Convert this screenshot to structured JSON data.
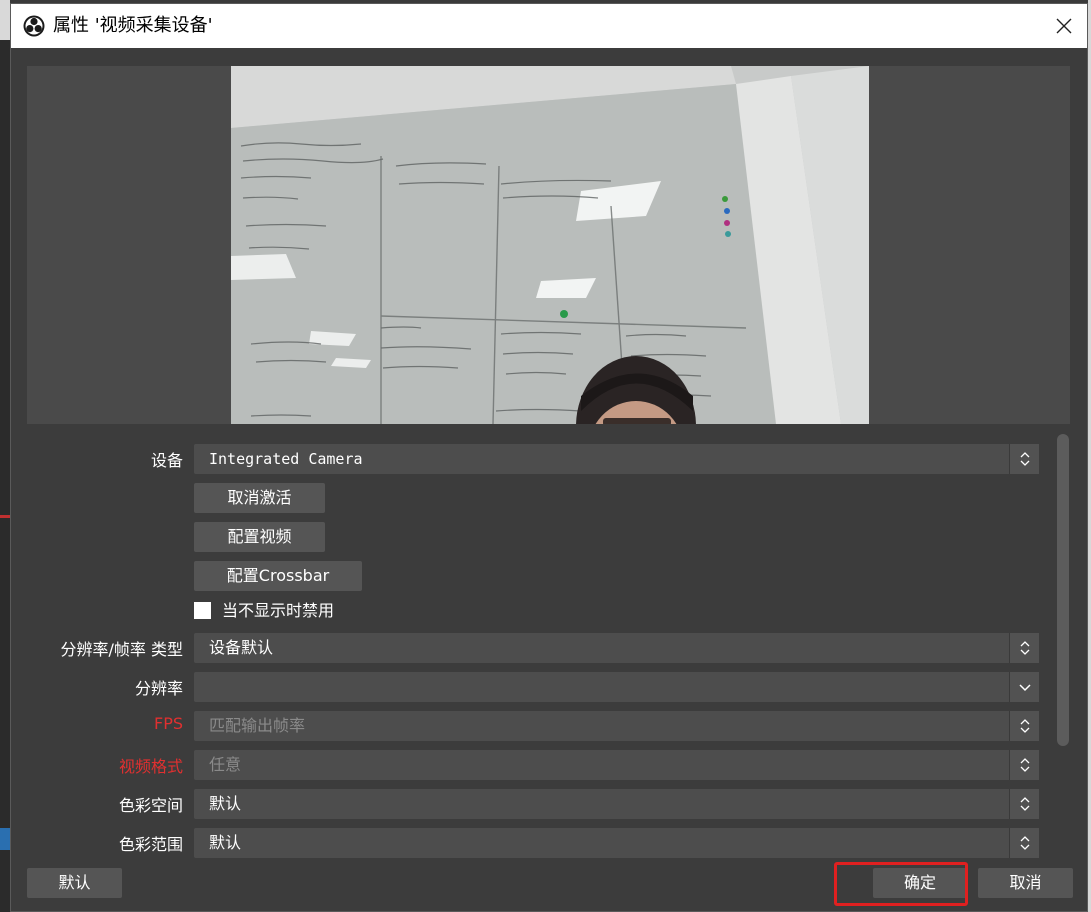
{
  "window": {
    "title": "属性 '视频采集设备'"
  },
  "form": {
    "device": {
      "label": "设备",
      "value": "Integrated Camera"
    },
    "deactivate_button": "取消激活",
    "config_video_button": "配置视频",
    "config_crossbar_button": "配置Crossbar",
    "disable_when_hidden": {
      "label": "当不显示时禁用",
      "checked": false
    },
    "res_fps_type": {
      "label": "分辨率/帧率 类型",
      "value": "设备默认"
    },
    "resolution": {
      "label": "分辨率",
      "value": ""
    },
    "fps": {
      "label": "FPS",
      "value": "匹配输出帧率"
    },
    "video_format": {
      "label": "视频格式",
      "value": "任意"
    },
    "color_space": {
      "label": "色彩空间",
      "value": "默认"
    },
    "color_range": {
      "label": "色彩范围",
      "value": "默认"
    }
  },
  "footer": {
    "defaults_button": "默认",
    "ok_button": "确定",
    "cancel_button": "取消"
  },
  "colors": {
    "window_bg": "#3c3c3c",
    "disabled_label_red": "#e03030",
    "highlight_red": "#e02020"
  }
}
